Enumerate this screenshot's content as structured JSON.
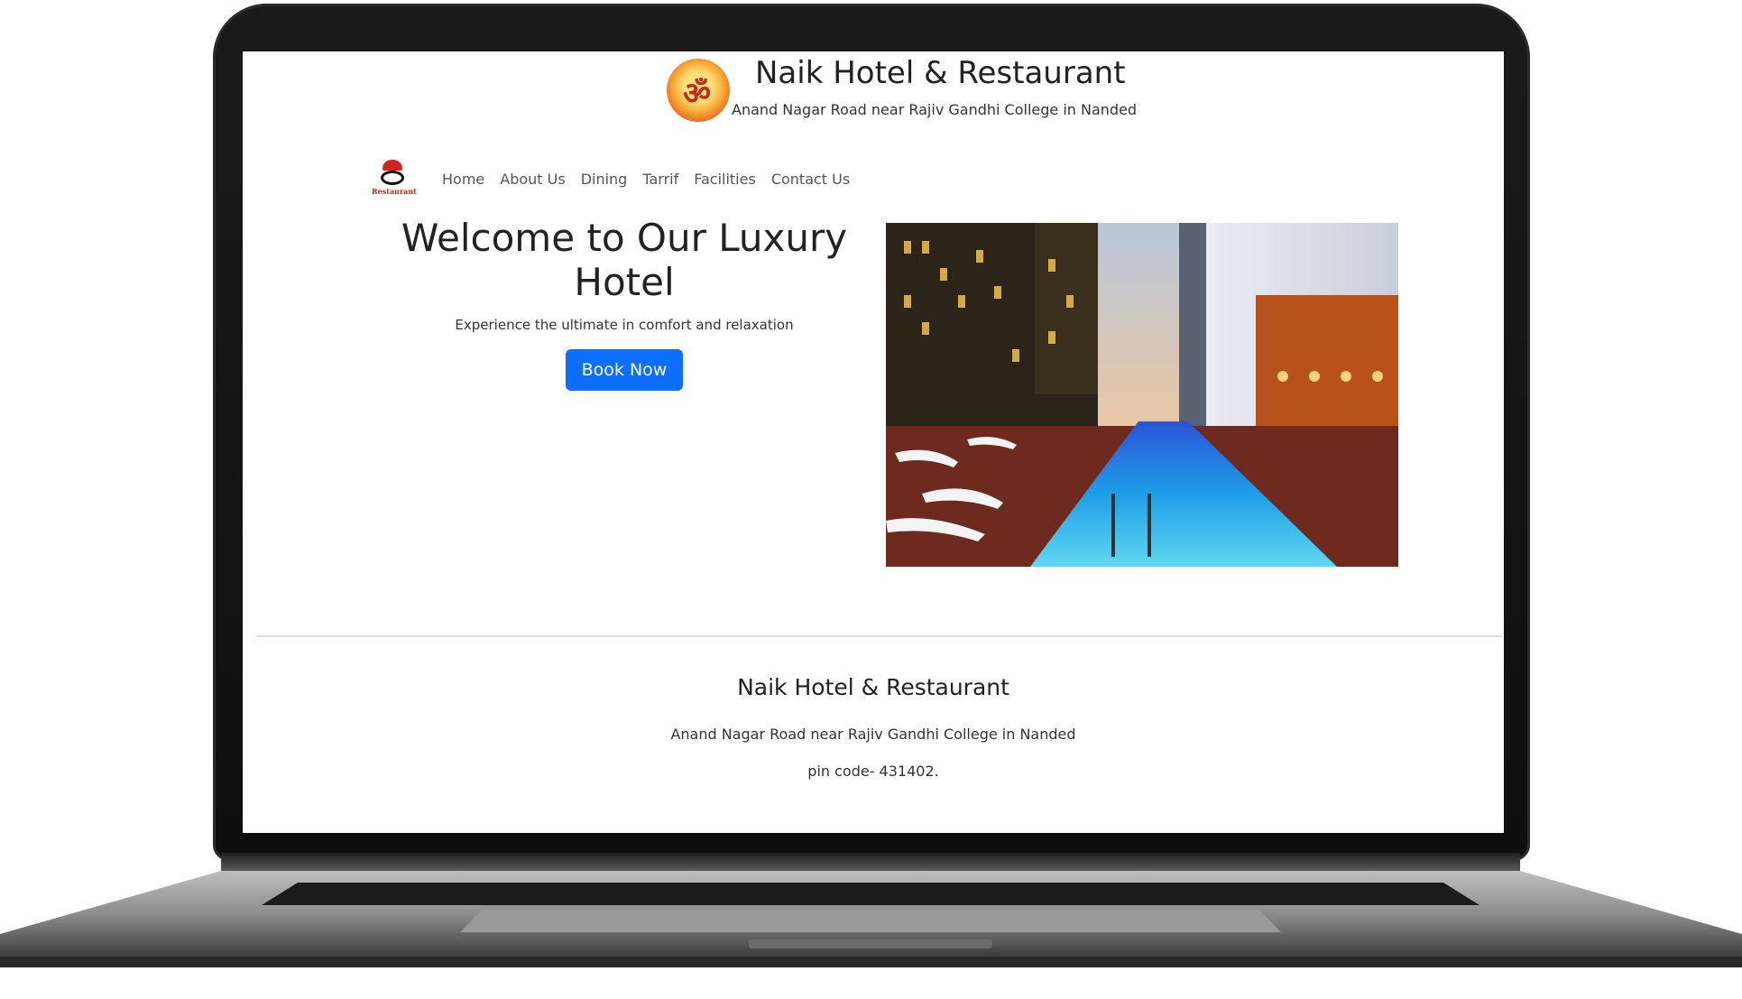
{
  "header": {
    "title": "Naik Hotel & Restaurant",
    "address": "Anand Nagar Road near Rajiv Gandhi College in Nanded"
  },
  "navbar": {
    "logo_text": "Restaurant",
    "links": [
      "Home",
      "About Us",
      "Dining",
      "Tarrif",
      "Facilities",
      "Contact Us"
    ]
  },
  "hero": {
    "title": "Welcome to Our Luxury Hotel",
    "subtitle": "Experience the ultimate in comfort and relaxation",
    "cta_label": "Book Now"
  },
  "footer": {
    "title": "Naik Hotel & Restaurant",
    "address": "Anand Nagar Road near Rajiv Gandhi College in Nanded",
    "pincode": "pin code- 431402."
  },
  "colors": {
    "primary_button": "#0d6efd",
    "text": "#222222",
    "laptop_frame": "#111111"
  }
}
